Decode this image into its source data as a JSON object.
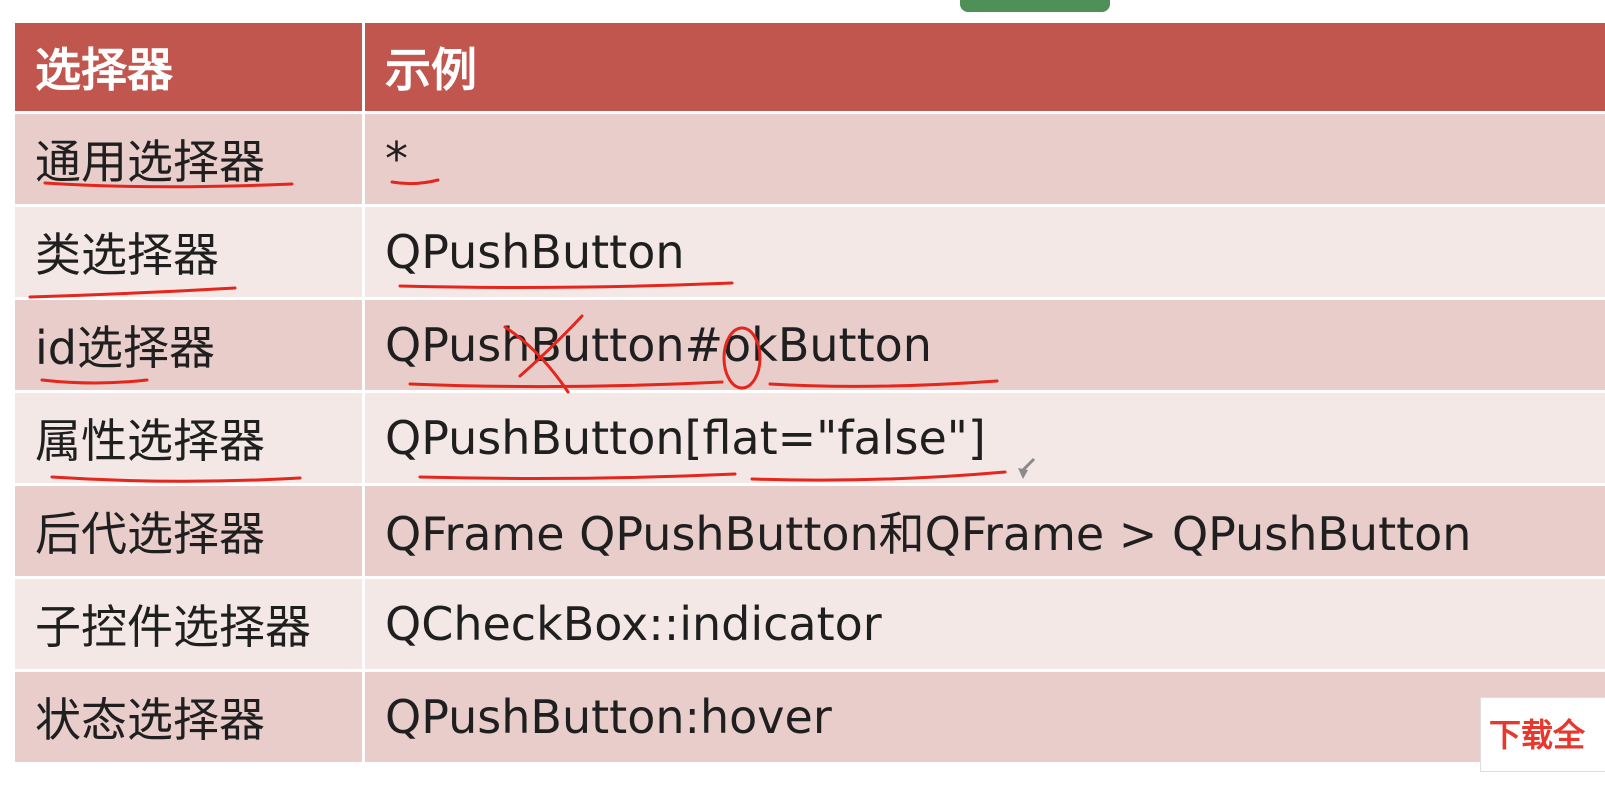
{
  "table": {
    "headers": [
      "选择器",
      "示例"
    ],
    "rows": [
      {
        "selector": "通用选择器",
        "example": "*"
      },
      {
        "selector": "类选择器",
        "example": "QPushButton"
      },
      {
        "selector": "id选择器",
        "example": "QPushButton#okButton"
      },
      {
        "selector": "属性选择器",
        "example": "QPushButton[flat=\"false\"]"
      },
      {
        "selector": "后代选择器",
        "example": "QFrame QPushButton和QFrame > QPushButton"
      },
      {
        "selector": "子控件选择器",
        "example": "QCheckBox::indicator"
      },
      {
        "selector": "状态选择器",
        "example": "QPushButton:hover"
      }
    ]
  },
  "badge": {
    "text": "下载全"
  },
  "colors": {
    "header_bg": "#c0564d",
    "row_odd_bg": "#e8cdcb",
    "row_even_bg": "#f4e8e7",
    "annotation_ink": "#e4261c",
    "badge_text": "#e8382e"
  }
}
